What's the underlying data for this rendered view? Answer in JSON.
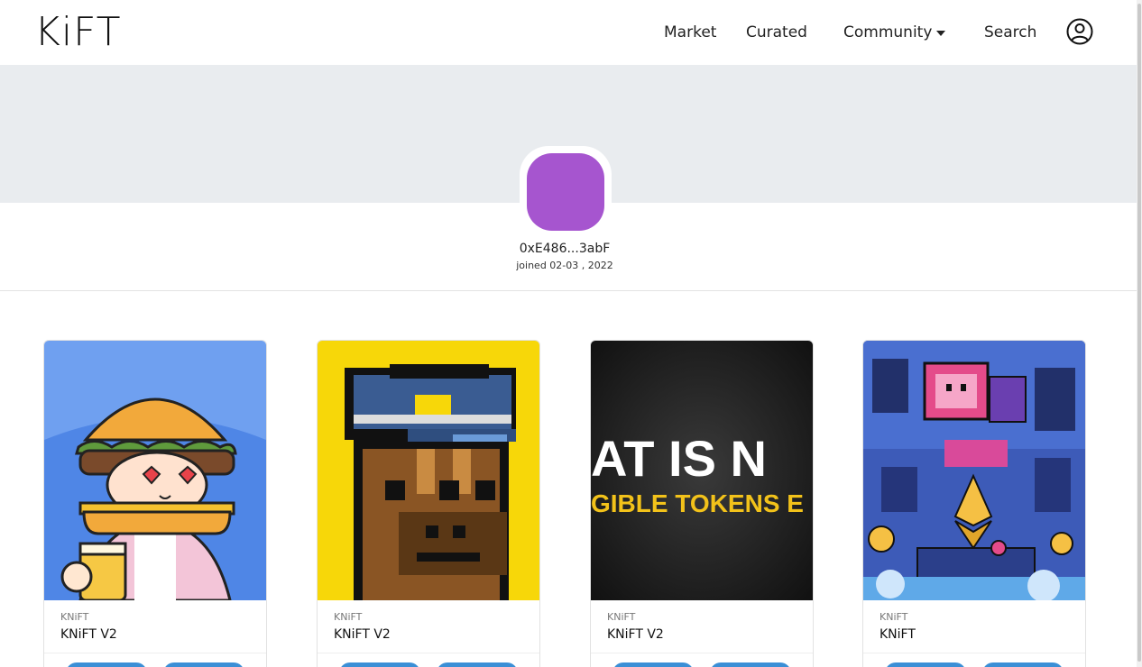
{
  "brand": {
    "logo": "KiFT"
  },
  "nav": {
    "market": "Market",
    "curated": "Curated",
    "community": "Community",
    "search": "Search"
  },
  "profile": {
    "address": "0xE486...3abF",
    "joined": "joined 02-03 , 2022",
    "avatar_color": "#a655cf",
    "banner_color": "#e9ecef"
  },
  "cards": [
    {
      "collection": "KNiFT",
      "title": "KNiFT V2"
    },
    {
      "collection": "KNiFT",
      "title": "KNiFT V2"
    },
    {
      "collection": "KNiFT",
      "title": "KNiFT V2"
    },
    {
      "collection": "KNiFT",
      "title": "KNiFT"
    }
  ],
  "card3_art": {
    "line1": "AT IS N",
    "line2": "GIBLE TOKENS E"
  },
  "colors": {
    "accent": "#3b8fd6"
  }
}
